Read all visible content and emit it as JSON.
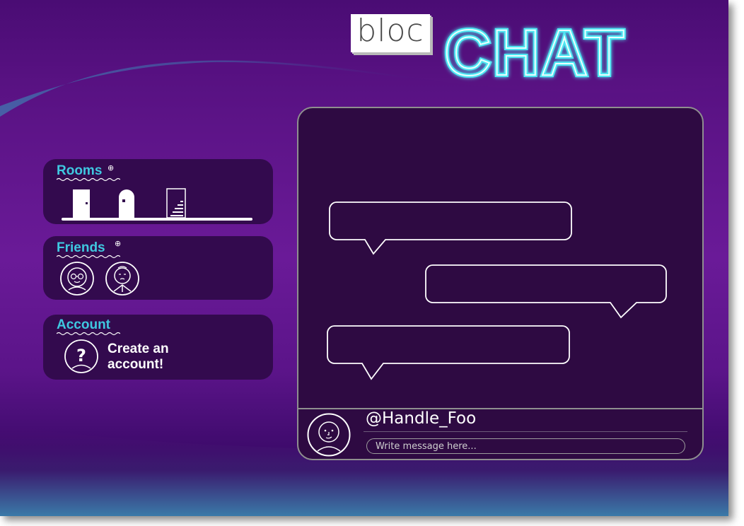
{
  "logo": {
    "bloc_text": "bloc",
    "chat_text": "CHAT"
  },
  "sidebar": {
    "rooms": {
      "title": "Rooms",
      "add_symbol": "⊕"
    },
    "friends": {
      "title": "Friends",
      "add_symbol": "⊕"
    },
    "account": {
      "title": "Account",
      "cta_line1": "Create an",
      "cta_line2": "account!"
    }
  },
  "composer": {
    "handle": "@Handle_Foo",
    "placeholder": "Write message here..."
  },
  "colors": {
    "accent_cyan": "#3fc8e0",
    "panel_bg": "#330a4e",
    "chat_bg": "#2e0a42"
  }
}
